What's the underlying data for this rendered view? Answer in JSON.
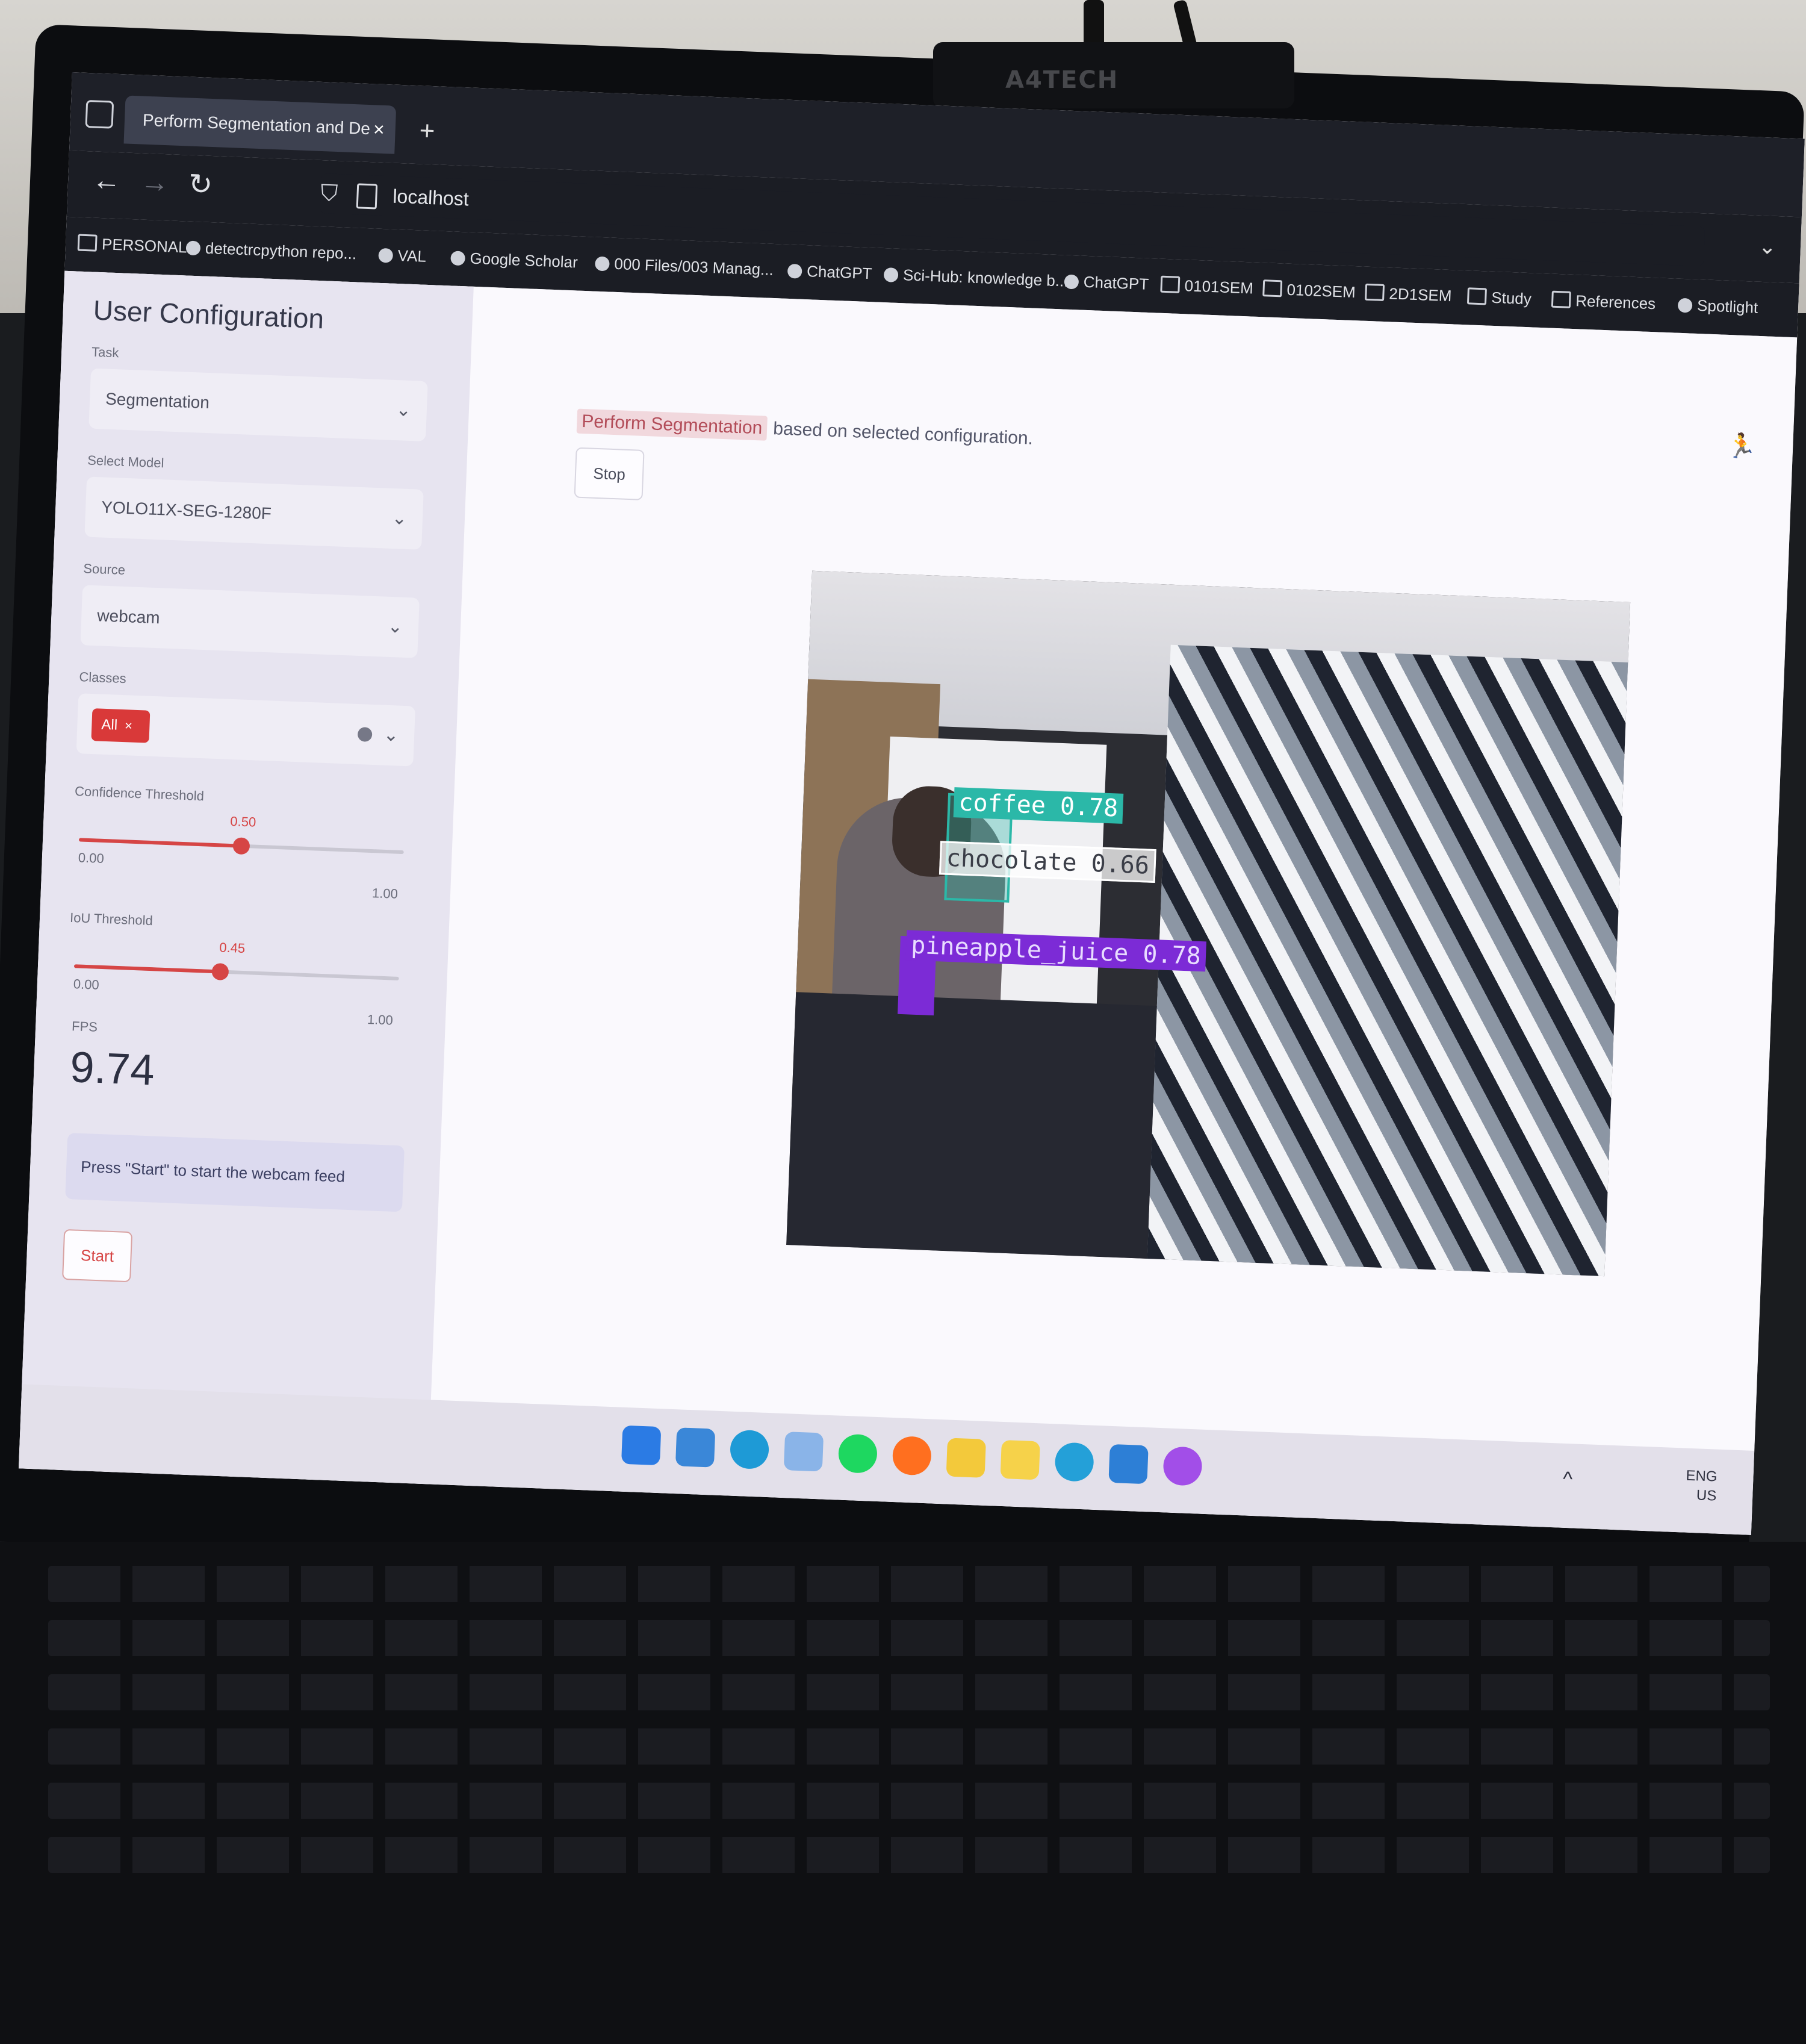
{
  "webcam_brand": "A4TECH",
  "browser": {
    "tab_title": "Perform Segmentation and De",
    "url": "localhost",
    "bookmarks": [
      "PERSONAL",
      "detectrcpython repo...",
      "VAL",
      "Google Scholar",
      "000 Files/003 Manag...",
      "ChatGPT",
      "Sci-Hub: knowledge b...",
      "ChatGPT",
      "0101SEM",
      "0102SEM",
      "2D1SEM",
      "Study",
      "References",
      "Spotlight"
    ]
  },
  "sidebar": {
    "title": "User Configuration",
    "task": {
      "label": "Task",
      "value": "Segmentation"
    },
    "model": {
      "label": "Select Model",
      "value": "YOLO11X-SEG-1280F"
    },
    "source": {
      "label": "Source",
      "value": "webcam"
    },
    "classes": {
      "label": "Classes",
      "chip": "All",
      "chip_close": "×"
    },
    "confidence": {
      "label": "Confidence Threshold",
      "value": "0.50",
      "value_num": 0.5,
      "min": "0.00",
      "max": "1.00"
    },
    "iou": {
      "label": "IoU Threshold",
      "value": "0.45",
      "value_num": 0.45,
      "min": "0.00",
      "max": "1.00"
    },
    "fps": {
      "label": "FPS",
      "value": "9.74"
    },
    "info": "Press \"Start\" to start the webcam feed",
    "start_label": "Start"
  },
  "main": {
    "heading_highlight": "Perform Segmentation",
    "heading_rest": "based on selected configuration.",
    "stop_label": "Stop"
  },
  "detections": [
    {
      "label": "coffee 0.78",
      "color": "#2bb8a8"
    },
    {
      "label": "chocolate 0.66",
      "color": "#ffffff"
    },
    {
      "label": "pineapple_juice 0.78",
      "color": "#7c2bd6"
    }
  ],
  "taskbar": {
    "lang": "ENG",
    "region": "US",
    "icons": [
      "windows-icon",
      "widgets-icon",
      "edge-icon",
      "photos-icon",
      "spotify-icon",
      "firefox-icon",
      "file-explorer-icon",
      "notes-icon",
      "chrome-icon",
      "vscode-icon",
      "messenger-icon"
    ]
  }
}
